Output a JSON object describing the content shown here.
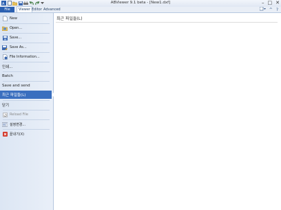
{
  "window": {
    "title": "ABViewer 9.1 beta - [New1.dxf]",
    "controls": [
      "–",
      "□",
      "✕"
    ]
  },
  "ribbon_tabs": [
    {
      "label": "File",
      "active": true
    },
    {
      "label": "Viewer"
    },
    {
      "label": "Editor"
    },
    {
      "label": "Advanced"
    }
  ],
  "ribbon_right": {
    "help": "?",
    "up": "^"
  },
  "backstage": {
    "items": [
      {
        "label": "New",
        "icon": "new-file-icon"
      },
      {
        "label": "Open...",
        "icon": "open-folder-icon"
      },
      {
        "label": "Save...",
        "icon": "save-icon"
      },
      {
        "label": "Save As...",
        "icon": "save-as-icon"
      },
      {
        "label": "File Information...",
        "icon": "file-info-icon"
      },
      {
        "label": "인쇄..."
      },
      {
        "label": "Batch"
      },
      {
        "label": "Save and send"
      },
      {
        "label": "최근 파일들(L)",
        "selected": true
      },
      {
        "label": "닫기"
      },
      {
        "label": "Reload File",
        "icon": "reload-icon",
        "disabled": true
      },
      {
        "label": "설정변경...",
        "icon": "settings-icon"
      },
      {
        "label": "끝내기(X)",
        "icon": "exit-icon"
      }
    ]
  },
  "content": {
    "title": "최근 파일들(L)"
  },
  "colors": {
    "file_tab": "#2a5fb0",
    "selected": "#3a6fbf",
    "exit_red": "#d33a2c"
  }
}
